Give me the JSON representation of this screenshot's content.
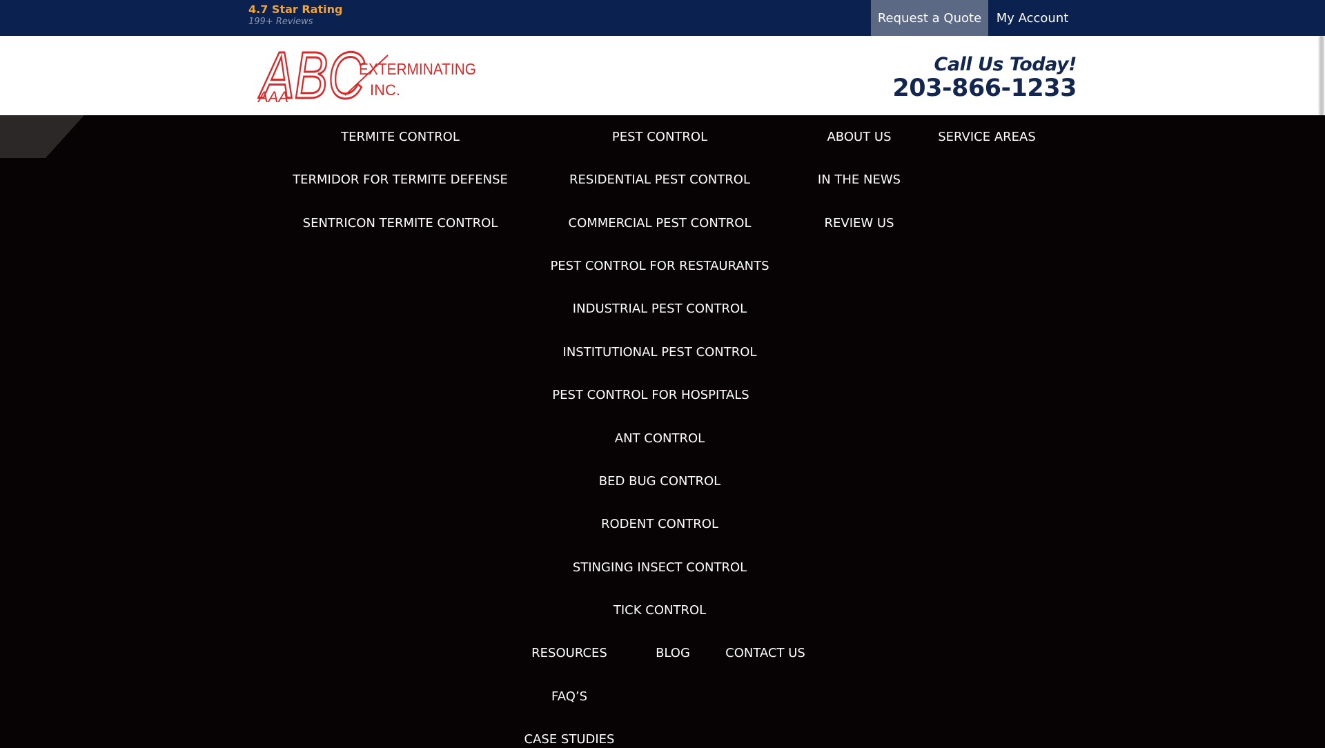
{
  "topbar": {
    "rating_title": "4.7 Star Rating",
    "rating_sub": "199+ Reviews",
    "quote_button": "Request a Quote",
    "account_link": "My Account",
    "colors": {
      "bar": "#0b2251",
      "rating": "#f0a33a",
      "quote_bg": "#5b6985"
    }
  },
  "header": {
    "logo_text": {
      "abc": "ABC",
      "aaa": "AAA",
      "exterminating": "EXTERMINATING",
      "inc": "INC."
    },
    "call_label": "Call Us Today!",
    "phone": "203-866-1233",
    "colors": {
      "logo": "#d72b2b",
      "phone": "#132650"
    }
  },
  "nav": {
    "termite": {
      "heading": "TERMITE CONTROL",
      "items": [
        "TERMIDOR FOR TERMITE DEFENSE",
        "SENTRICON TERMITE CONTROL"
      ]
    },
    "pest": {
      "heading": "PEST CONTROL",
      "items": [
        "RESIDENTIAL PEST CONTROL",
        "COMMERCIAL PEST CONTROL",
        "PEST CONTROL FOR RESTAURANTS",
        "INDUSTRIAL PEST CONTROL",
        "INSTITUTIONAL PEST CONTROL",
        "PEST CONTROL FOR HOSPITALS",
        "ANT CONTROL",
        "BED BUG CONTROL",
        "RODENT CONTROL",
        "STINGING INSECT CONTROL",
        "TICK CONTROL"
      ]
    },
    "about": {
      "heading": "ABOUT US",
      "items": [
        "IN THE NEWS",
        "REVIEW US"
      ]
    },
    "service_areas": "SERVICE AREAS",
    "resources": {
      "heading": "RESOURCES",
      "items": [
        "FAQ’S",
        "CASE STUDIES"
      ]
    },
    "blog": "BLOG",
    "contact": "CONTACT US"
  }
}
